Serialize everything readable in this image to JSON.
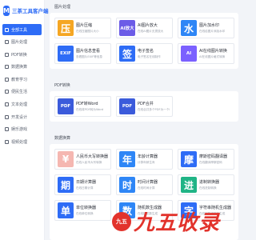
{
  "app": {
    "logo_mark": "M",
    "title": "三茶工具客户端"
  },
  "sidebar": {
    "items": [
      {
        "label": "全部工具",
        "active": true
      },
      {
        "label": "图片处理"
      },
      {
        "label": "PDF转换"
      },
      {
        "label": "数据换算"
      },
      {
        "label": "教育学习"
      },
      {
        "label": "便民生活"
      },
      {
        "label": "文本处理"
      },
      {
        "label": "开发设计"
      },
      {
        "label": "娱乐游戏"
      },
      {
        "label": "视频处理"
      }
    ]
  },
  "sections": [
    {
      "label": "图片处理",
      "cards": [
        {
          "glyph": "压",
          "color": "#f5a623",
          "title": "图片压缩",
          "desc": "在线压缩图片大小"
        },
        {
          "glyph": "AI放大",
          "color": "#6c5ce7",
          "title": "AI图片放大",
          "desc": "在线AI图片无损放大",
          "small": true
        },
        {
          "glyph": "水",
          "color": "#2e86f6",
          "title": "图片加水印",
          "desc": "在线给图片添加水印"
        },
        {
          "glyph": "EXIF",
          "color": "#2e6cf6",
          "title": "图片信息查看",
          "desc": "查看图片EXIF等信息",
          "small": true
        },
        {
          "glyph": "签",
          "color": "#2e6cf6",
          "title": "电子签名",
          "desc": "电子签名在线制作"
        },
        {
          "glyph": "AI",
          "color": "#7b61ff",
          "title": "AI在线图片转换",
          "desc": "AI在线图片格式转换",
          "small": true
        }
      ]
    },
    {
      "label": "PDF转换",
      "cards": [
        {
          "glyph": "PDF",
          "color": "#3b5bdb",
          "title": "PDF转Word",
          "desc": "在线将PDF转为Word",
          "small": true
        },
        {
          "glyph": "PDF",
          "color": "#3b5bdb",
          "title": "PDF合并",
          "desc": "在线合并多个PDF为一个PDF",
          "small": true
        }
      ]
    },
    {
      "label": "数据换算",
      "cards": [
        {
          "glyph": "¥",
          "color": "#f5b7b1",
          "title": "人民币大写转换器",
          "desc": "在线人民币大写转换"
        },
        {
          "glyph": "年",
          "color": "#2e86f6",
          "title": "年龄计算器",
          "desc": "计算年龄生肖"
        },
        {
          "glyph": "摩",
          "color": "#2e6cf6",
          "title": "摩斯密码翻译器",
          "desc": "在线翻译摩斯密码"
        },
        {
          "glyph": "期",
          "color": "#2e6cf6",
          "title": "日期计算器",
          "desc": "在线日期计算"
        },
        {
          "glyph": "时",
          "color": "#2e86f6",
          "title": "时间计算器",
          "desc": "在线时间计算"
        },
        {
          "glyph": "进",
          "color": "#20b486",
          "title": "进制转换器",
          "desc": "在线进制转换"
        },
        {
          "glyph": "单",
          "color": "#2e6cf6",
          "title": "单位转换器",
          "desc": "在线单位转换"
        },
        {
          "glyph": "数",
          "color": "#2e86f6",
          "title": "随机数生成器",
          "desc": "在线随机数生成"
        },
        {
          "glyph": "字",
          "color": "#2e6cf6",
          "title": "字符串随机生成器",
          "desc": "在线字符串随机生成"
        }
      ]
    }
  ],
  "watermark": {
    "mark": "九五",
    "text": "九五收录"
  }
}
